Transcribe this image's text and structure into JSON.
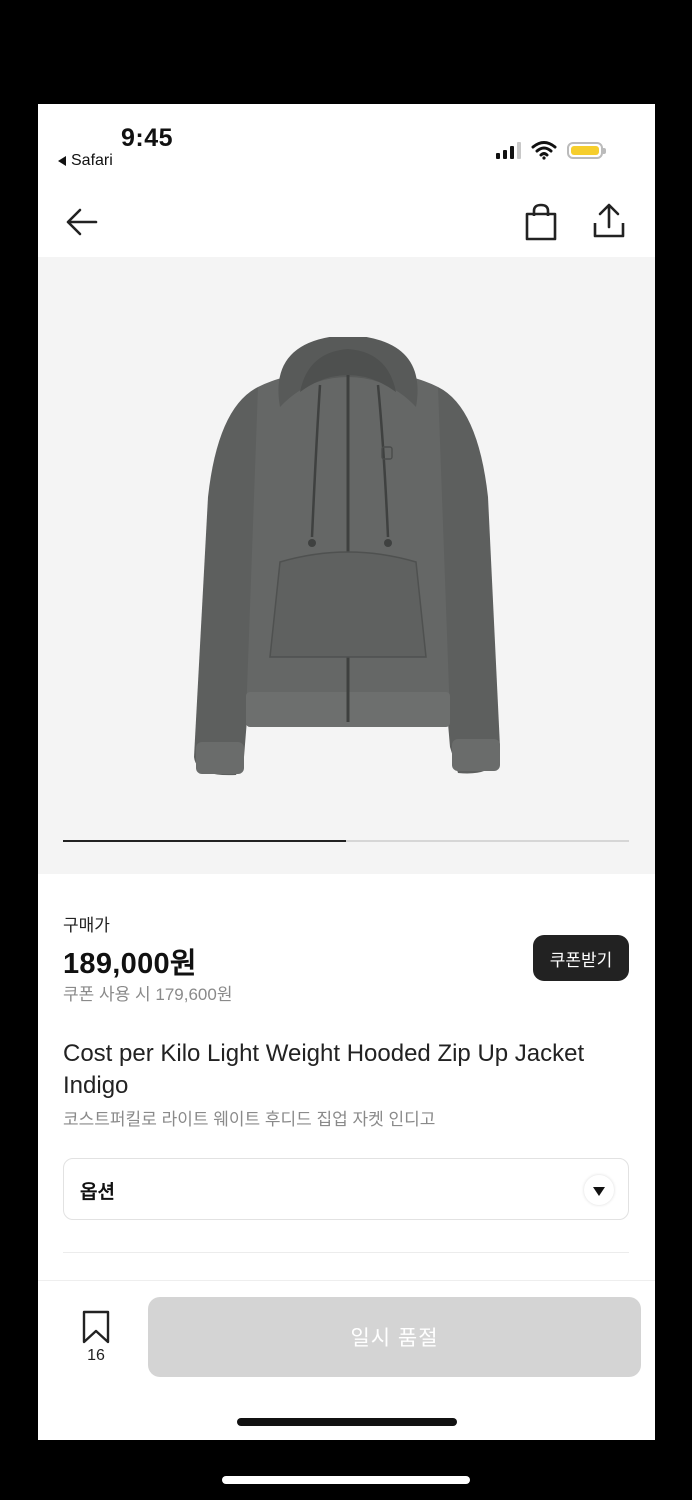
{
  "status_bar": {
    "time": "9:45",
    "back_app": "Safari",
    "battery_color": "#f6ce2c"
  },
  "nav": {
    "back_icon": "arrow-left-icon",
    "bag_icon": "shopping-bag-icon",
    "share_icon": "share-icon"
  },
  "gallery": {
    "image": "gray hooded zip-up jacket",
    "progress_fraction": 0.5
  },
  "pricing": {
    "label": "구매가",
    "price": "189,000원",
    "coupon_price": "쿠폰 사용 시 179,600원",
    "coupon_button": "쿠폰받기"
  },
  "product": {
    "title": "Cost per Kilo Light Weight Hooded Zip Up Jacket Indigo",
    "subtitle": "코스트퍼킬로 라이트 웨이트 후디드 집업 자켓 인디고"
  },
  "option": {
    "label": "옵션",
    "icon": "dropdown-arrow-icon"
  },
  "bottom_bar": {
    "bookmark_icon": "bookmark-icon",
    "bookmark_count": "16",
    "action_label": "일시 품절",
    "action_color": "#d4d4d4"
  }
}
